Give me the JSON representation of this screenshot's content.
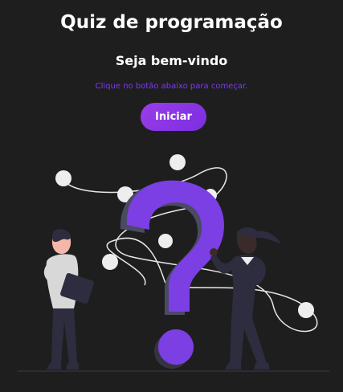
{
  "app": {
    "title": "Quiz de programação",
    "welcome": "Seja bem-vindo",
    "hint": "Clique no botão abaixo para começar.",
    "start_button": "Iniciar"
  },
  "colors": {
    "background": "#1e1e1f",
    "accent": "#7c3aed",
    "question_mark": "#7b3fe4",
    "text": "#ffffff"
  },
  "illustration": {
    "icon": "question-mark-people-illustration"
  }
}
